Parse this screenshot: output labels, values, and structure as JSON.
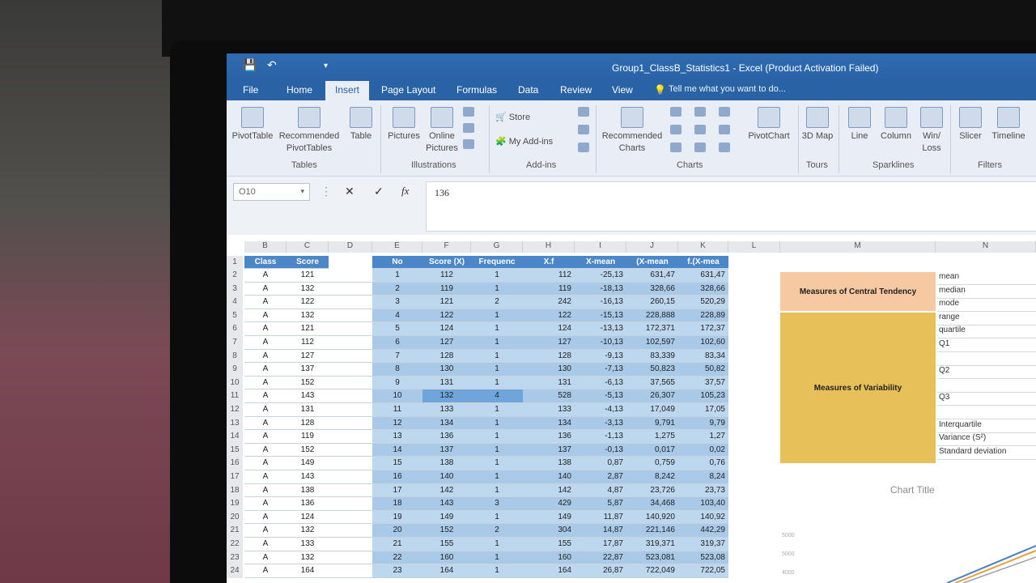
{
  "window": {
    "title": "Group1_ClassB_Statistics1 - Excel (Product Activation Failed)"
  },
  "tabs": [
    "File",
    "Home",
    "Insert",
    "Page Layout",
    "Formulas",
    "Data",
    "Review",
    "View"
  ],
  "tell_me": "Tell me what you want to do...",
  "ribbon": {
    "pivottable": "PivotTable",
    "recommended_pivottables": "Recommended PivotTables",
    "table": "Table",
    "pictures": "Pictures",
    "online_pictures": "Online Pictures",
    "store": "Store",
    "my_addins": "My Add-ins",
    "recommended_charts": "Recommended Charts",
    "pivotchart": "PivotChart",
    "map3d": "3D Map",
    "line": "Line",
    "column": "Column",
    "winloss": "Win/ Loss",
    "slicer": "Slicer",
    "timeline": "Timeline",
    "groups": {
      "tables": "Tables",
      "illustrations": "Illustrations",
      "addins": "Add-ins",
      "charts": "Charts",
      "tours": "Tours",
      "sparklines": "Sparklines",
      "filters": "Filters"
    }
  },
  "formula_bar": {
    "name_box": "O10",
    "value": "136",
    "fx": "fx"
  },
  "columns": [
    "B",
    "C",
    "D",
    "E",
    "F",
    "G",
    "H",
    "I",
    "J",
    "K",
    "L",
    "M",
    "N"
  ],
  "headers": {
    "class": "Class",
    "score": "Score",
    "no": "No",
    "score_x": "Score (X)",
    "frequency": "Frequenc",
    "xf": "X.f",
    "xmean": "X-mean",
    "xmean_sq": "(X-mean",
    "fxmean": "f.(X-mea"
  },
  "rows": [
    {
      "r": "2",
      "cls": "A",
      "score": "121",
      "no": "1",
      "x": "112",
      "f": "1",
      "xf": "112",
      "xm": "-25,13",
      "sq": "631,47",
      "fsq": "631,47"
    },
    {
      "r": "3",
      "cls": "A",
      "score": "132",
      "no": "2",
      "x": "119",
      "f": "1",
      "xf": "119",
      "xm": "-18,13",
      "sq": "328,66",
      "fsq": "328,66"
    },
    {
      "r": "4",
      "cls": "A",
      "score": "122",
      "no": "3",
      "x": "121",
      "f": "2",
      "xf": "242",
      "xm": "-16,13",
      "sq": "260,15",
      "fsq": "520,29"
    },
    {
      "r": "5",
      "cls": "A",
      "score": "132",
      "no": "4",
      "x": "122",
      "f": "1",
      "xf": "122",
      "xm": "-15,13",
      "sq": "228,888",
      "fsq": "228,89"
    },
    {
      "r": "6",
      "cls": "A",
      "score": "121",
      "no": "5",
      "x": "124",
      "f": "1",
      "xf": "124",
      "xm": "-13,13",
      "sq": "172,371",
      "fsq": "172,37"
    },
    {
      "r": "7",
      "cls": "A",
      "score": "112",
      "no": "6",
      "x": "127",
      "f": "1",
      "xf": "127",
      "xm": "-10,13",
      "sq": "102,597",
      "fsq": "102,60"
    },
    {
      "r": "8",
      "cls": "A",
      "score": "127",
      "no": "7",
      "x": "128",
      "f": "1",
      "xf": "128",
      "xm": "-9,13",
      "sq": "83,339",
      "fsq": "83,34"
    },
    {
      "r": "9",
      "cls": "A",
      "score": "137",
      "no": "8",
      "x": "130",
      "f": "1",
      "xf": "130",
      "xm": "-7,13",
      "sq": "50,823",
      "fsq": "50,82"
    },
    {
      "r": "10",
      "cls": "A",
      "score": "152",
      "no": "9",
      "x": "131",
      "f": "1",
      "xf": "131",
      "xm": "-6,13",
      "sq": "37,565",
      "fsq": "37,57"
    },
    {
      "r": "11",
      "cls": "A",
      "score": "143",
      "no": "10",
      "x": "132",
      "f": "4",
      "xf": "528",
      "xm": "-5,13",
      "sq": "26,307",
      "fsq": "105,23"
    },
    {
      "r": "12",
      "cls": "A",
      "score": "131",
      "no": "11",
      "x": "133",
      "f": "1",
      "xf": "133",
      "xm": "-4,13",
      "sq": "17,049",
      "fsq": "17,05"
    },
    {
      "r": "13",
      "cls": "A",
      "score": "128",
      "no": "12",
      "x": "134",
      "f": "1",
      "xf": "134",
      "xm": "-3,13",
      "sq": "9,791",
      "fsq": "9,79"
    },
    {
      "r": "14",
      "cls": "A",
      "score": "119",
      "no": "13",
      "x": "136",
      "f": "1",
      "xf": "136",
      "xm": "-1,13",
      "sq": "1,275",
      "fsq": "1,27"
    },
    {
      "r": "15",
      "cls": "A",
      "score": "152",
      "no": "14",
      "x": "137",
      "f": "1",
      "xf": "137",
      "xm": "-0,13",
      "sq": "0,017",
      "fsq": "0,02"
    },
    {
      "r": "16",
      "cls": "A",
      "score": "149",
      "no": "15",
      "x": "138",
      "f": "1",
      "xf": "138",
      "xm": "0,87",
      "sq": "0,759",
      "fsq": "0,76"
    },
    {
      "r": "17",
      "cls": "A",
      "score": "143",
      "no": "16",
      "x": "140",
      "f": "1",
      "xf": "140",
      "xm": "2,87",
      "sq": "8,242",
      "fsq": "8,24"
    },
    {
      "r": "18",
      "cls": "A",
      "score": "138",
      "no": "17",
      "x": "142",
      "f": "1",
      "xf": "142",
      "xm": "4,87",
      "sq": "23,726",
      "fsq": "23,73"
    },
    {
      "r": "19",
      "cls": "A",
      "score": "136",
      "no": "18",
      "x": "143",
      "f": "3",
      "xf": "429",
      "xm": "5,87",
      "sq": "34,468",
      "fsq": "103,40"
    },
    {
      "r": "20",
      "cls": "A",
      "score": "124",
      "no": "19",
      "x": "149",
      "f": "1",
      "xf": "149",
      "xm": "11,87",
      "sq": "140,920",
      "fsq": "140,92"
    },
    {
      "r": "21",
      "cls": "A",
      "score": "132",
      "no": "20",
      "x": "152",
      "f": "2",
      "xf": "304",
      "xm": "14,87",
      "sq": "221,146",
      "fsq": "442,29"
    },
    {
      "r": "22",
      "cls": "A",
      "score": "133",
      "no": "21",
      "x": "155",
      "f": "1",
      "xf": "155",
      "xm": "17,87",
      "sq": "319,371",
      "fsq": "319,37"
    },
    {
      "r": "23",
      "cls": "A",
      "score": "132",
      "no": "22",
      "x": "160",
      "f": "1",
      "xf": "160",
      "xm": "22,87",
      "sq": "523,081",
      "fsq": "523,08"
    },
    {
      "r": "24",
      "cls": "A",
      "score": "164",
      "no": "23",
      "x": "164",
      "f": "1",
      "xf": "164",
      "xm": "26,87",
      "sq": "722,049",
      "fsq": "722,05"
    }
  ],
  "measures": {
    "central_title": "Measures of Central Tendency",
    "variability_title": "Measures of Variability",
    "labels": [
      "mean",
      "median",
      "mode",
      "range",
      "quartile",
      "Q1",
      "",
      "Q2",
      "",
      "Q3",
      "",
      "Interquartile",
      "Variance (S²)",
      "Standard deviation"
    ]
  },
  "chart": {
    "title": "Chart Title",
    "ticks": [
      "5000",
      "5000",
      "4000"
    ]
  },
  "colors": {
    "blue_header": "#4a86c8",
    "light_blue": "#bdd7ee",
    "peach": "#f6c9a2",
    "gold": "#e8c05a"
  }
}
